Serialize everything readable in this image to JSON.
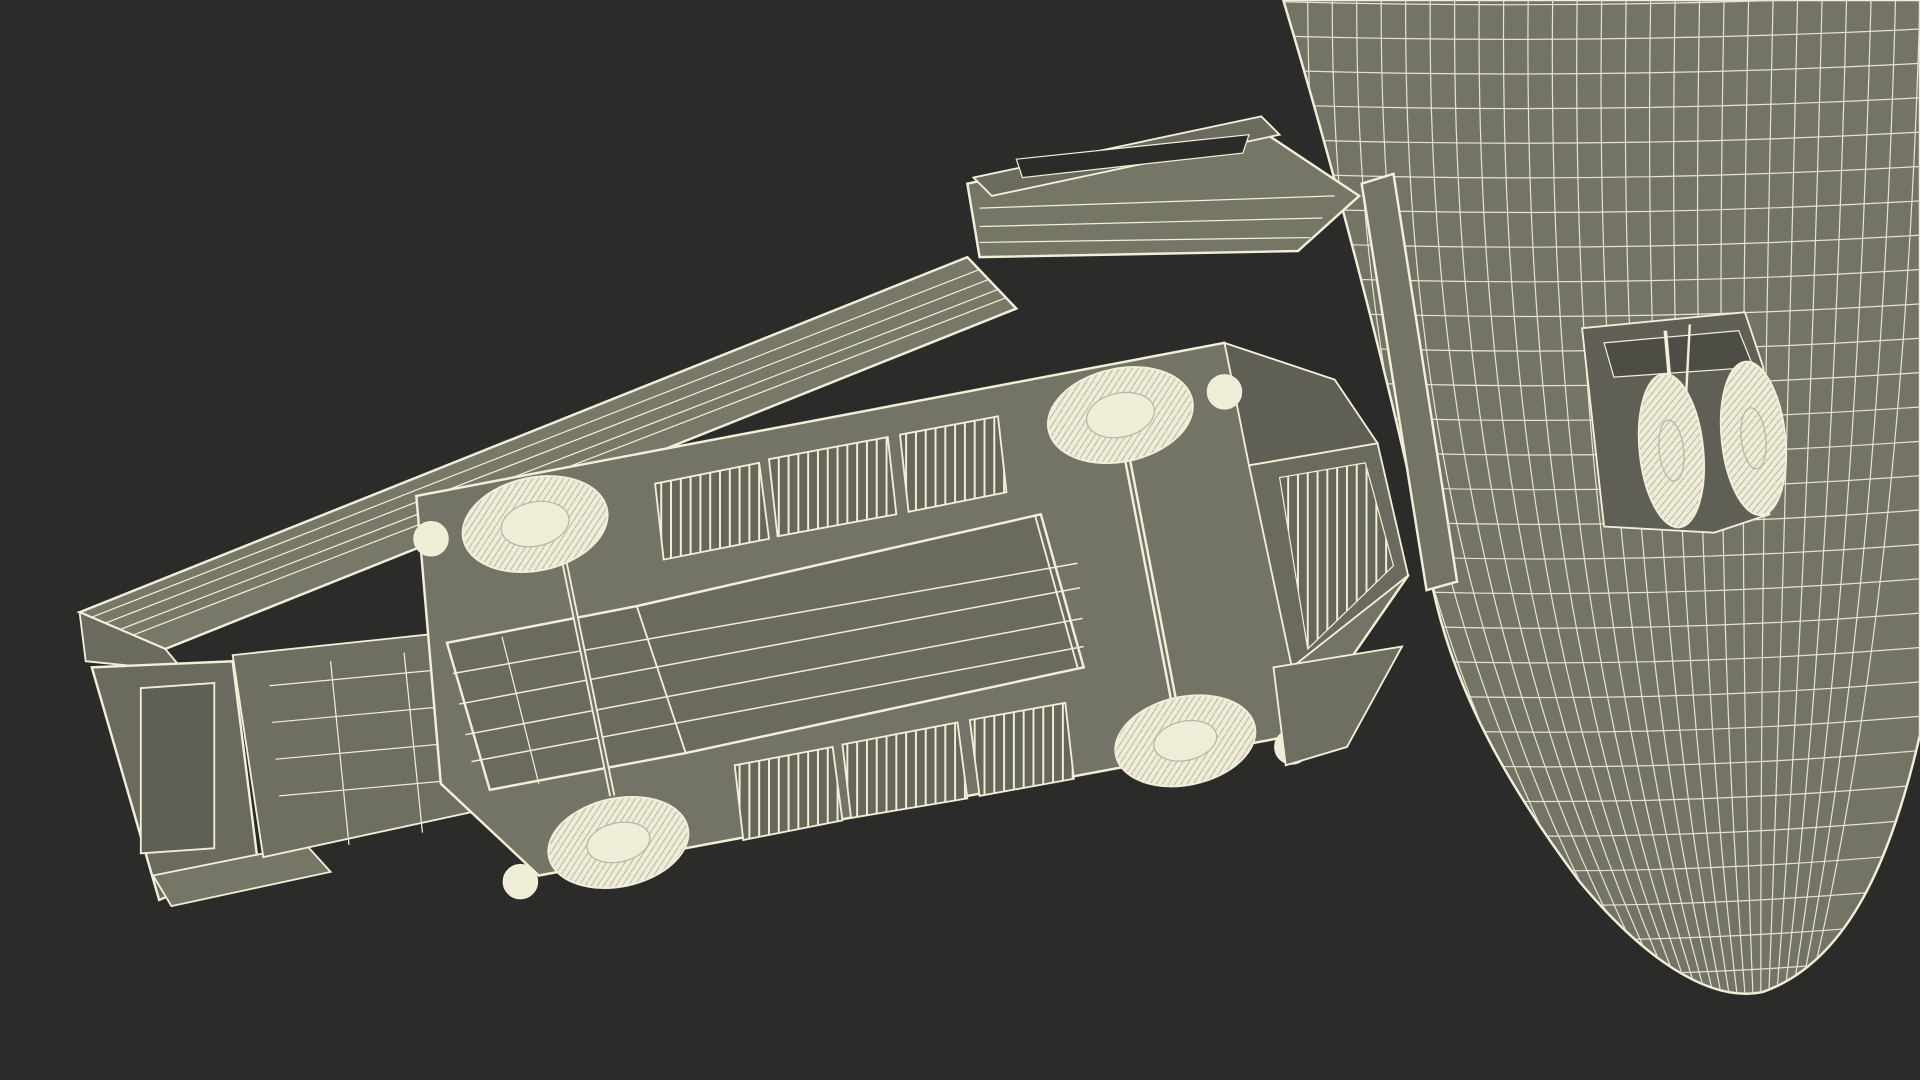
{
  "scene": {
    "background_color": "#2b2b29",
    "panel_fill": "#737366",
    "panel_fill_dark": "#5f5f55",
    "wire_color": "#f2efd9",
    "wire_color_dim": "#c9c6b1",
    "tire_fill": "#efecd8"
  }
}
